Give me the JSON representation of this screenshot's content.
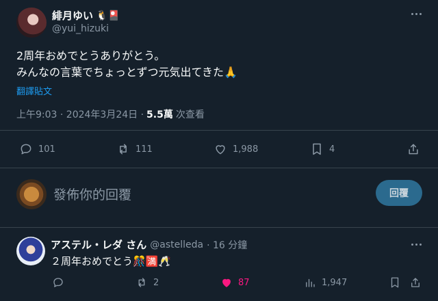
{
  "tweet": {
    "display_name": "緋月ゆい",
    "handle": "@yui_hizuki",
    "name_emojis": "🐧🎴",
    "line1": "2周年おめでとうありがとう。",
    "line2": "みんなの言葉でちょっとずつ元気出てきた🙏",
    "translate": "翻譯貼文",
    "time": "上午9:03 · 2024年3月24日 · ",
    "views_count": "5.5萬",
    "views_label": "次查看",
    "counts": {
      "replies": "101",
      "retweets": "111",
      "likes": "1,988",
      "bookmarks": "4"
    }
  },
  "composer": {
    "placeholder": "發佈你的回覆",
    "button": "回覆"
  },
  "reply": {
    "display_name": "アステル・レダ さん",
    "handle": "@astelleda",
    "age": "· 16 分鐘",
    "text": "２周年おめでとう🎊🈵🥂",
    "counts": {
      "retweets": "2",
      "likes": "87",
      "views": "1,947"
    }
  },
  "colors": {
    "background": "#15202b",
    "divider": "#38444d",
    "muted": "#8b98a5",
    "link": "#1d9bf0",
    "like_active": "#f91880",
    "button_bg": "#2b6a8e"
  },
  "icons": [
    "more-icon",
    "reply-icon",
    "retweet-icon",
    "like-icon",
    "bookmark-icon",
    "share-icon",
    "views-icon"
  ]
}
